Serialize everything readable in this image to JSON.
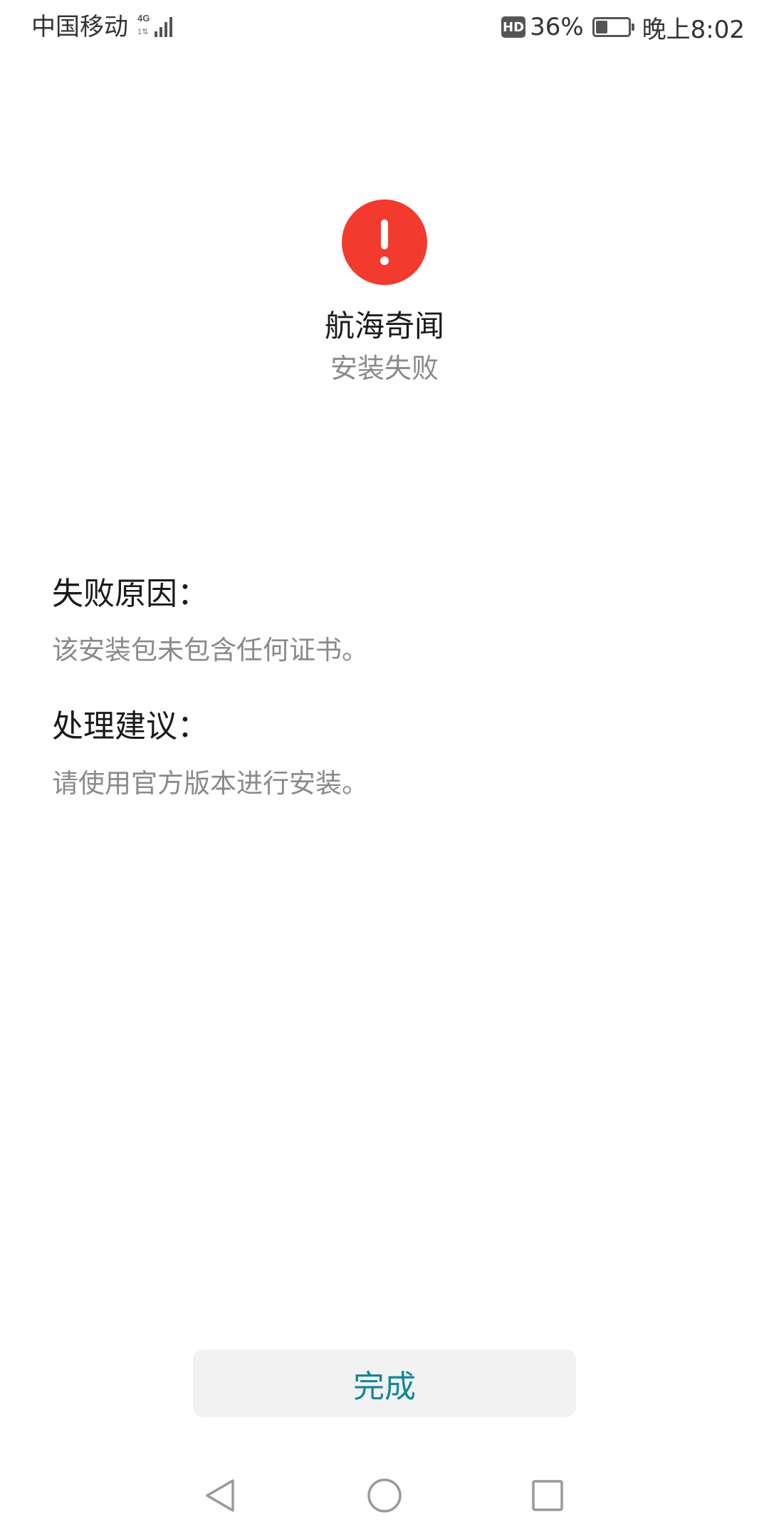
{
  "status_bar": {
    "carrier": "中国移动",
    "network_type": "4G",
    "network_sub": "1⇅",
    "hd_label": "HD",
    "battery_percent": "36%",
    "battery_level": 0.36,
    "time": "晚上8:02"
  },
  "header": {
    "icon": "error-exclamation-icon",
    "icon_color": "#f23a2f",
    "app_name": "航海奇闻",
    "status": "安装失败"
  },
  "failure": {
    "title": "失败原因：",
    "text": "该安装包未包含任何证书。"
  },
  "suggestion": {
    "title": "处理建议：",
    "text": "请使用官方版本进行安装。"
  },
  "done_button": {
    "label": "完成",
    "text_color": "#14869a"
  },
  "nav_bar": {
    "back": "back-triangle-icon",
    "home": "home-circle-icon",
    "recent": "recent-square-icon"
  }
}
